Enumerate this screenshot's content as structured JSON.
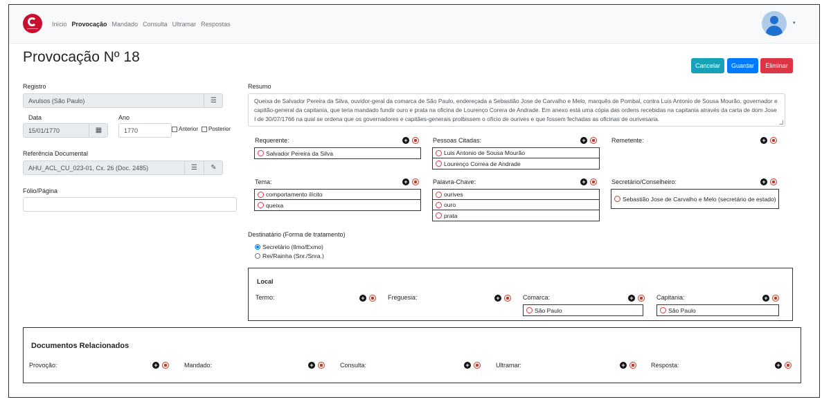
{
  "nav": {
    "links": [
      "Início",
      "Provocação",
      "Mandado",
      "Consulta",
      "Ultramar",
      "Respostas"
    ],
    "active": "Provocação"
  },
  "page": {
    "title": "Provocação Nº 18"
  },
  "actions": {
    "cancel": "Cancelar",
    "save": "Guardar",
    "delete": "Eliminar"
  },
  "form": {
    "registro_label": "Registro",
    "registro_value": "Avulsos (São Paulo)",
    "data_label": "Data",
    "data_value": "15/01/1770",
    "ano_label": "Ano",
    "ano_value": "1770",
    "anterior_label": "Anterior",
    "posterior_label": "Posterior",
    "referencia_label": "Referência Documental",
    "referencia_value": "AHU_ACL_CU_023-01, Cx. 26 (Doc. 2485)",
    "folio_label": "Fólio/Página",
    "folio_value": ""
  },
  "resumo": {
    "label": "Resumo",
    "text": "Queixa de Salvador Pereira da Silva, ouvidor-geral da comarca de São Paulo, endereçada a Sebastião Jose de Carvalho e Melo, marquês de Pombal, contra Luis Antonio de Sousa Mourão, governador e capitão-general da capitania, que teria mandado fundir ouro e prata na oficina de Lourenço Corera de Andrade. Em anexo está uma cópia das ordens recebidas na capitania através da carta de dom Jose I de 30/07/1766 na qual se ordena que os governadores e capitães-generais proibissem o ofício de ourives e que fossem fechadas as oficinas de ourivesaria."
  },
  "panels": {
    "requerente": {
      "label": "Requerente:",
      "items": [
        "Salvador Pereira da Silva"
      ]
    },
    "pessoas": {
      "label": "Pessoas Citadas:",
      "items": [
        "Luis Antonio de Sousa Mourão",
        "Lourenço Correa de Andrade"
      ]
    },
    "remetente": {
      "label": "Remetente:",
      "items": []
    },
    "tema": {
      "label": "Tema:",
      "items": [
        "comportamento ilícito",
        "queixa"
      ]
    },
    "palavra": {
      "label": "Palavra-Chave:",
      "items": [
        "ourives",
        "ouro",
        "prata"
      ]
    },
    "secretario": {
      "label": "Secretário/Conselheiro:",
      "items": [
        "Sebastião Jose de Carvalho e Melo (secretário de estado)"
      ]
    }
  },
  "destinatario": {
    "label": "Destinatário (Forma de tratamento)",
    "options": [
      "Secretário (Ilmo/Exmo)",
      "Rei/Rainha (Snr./Snra.)"
    ],
    "selected": 0
  },
  "local": {
    "title": "Local",
    "termo": "Termo:",
    "freguesia": "Freguesia:",
    "comarca": "Comarca:",
    "comarca_item": "São Paulo",
    "capitania": "Capitania:",
    "capitania_item": "São Paulo"
  },
  "docs": {
    "title": "Documentos Relacionados",
    "labels": [
      "Provoção:",
      "Mandado:",
      "Consulta:",
      "Ultramar:",
      "Resposta:"
    ]
  }
}
